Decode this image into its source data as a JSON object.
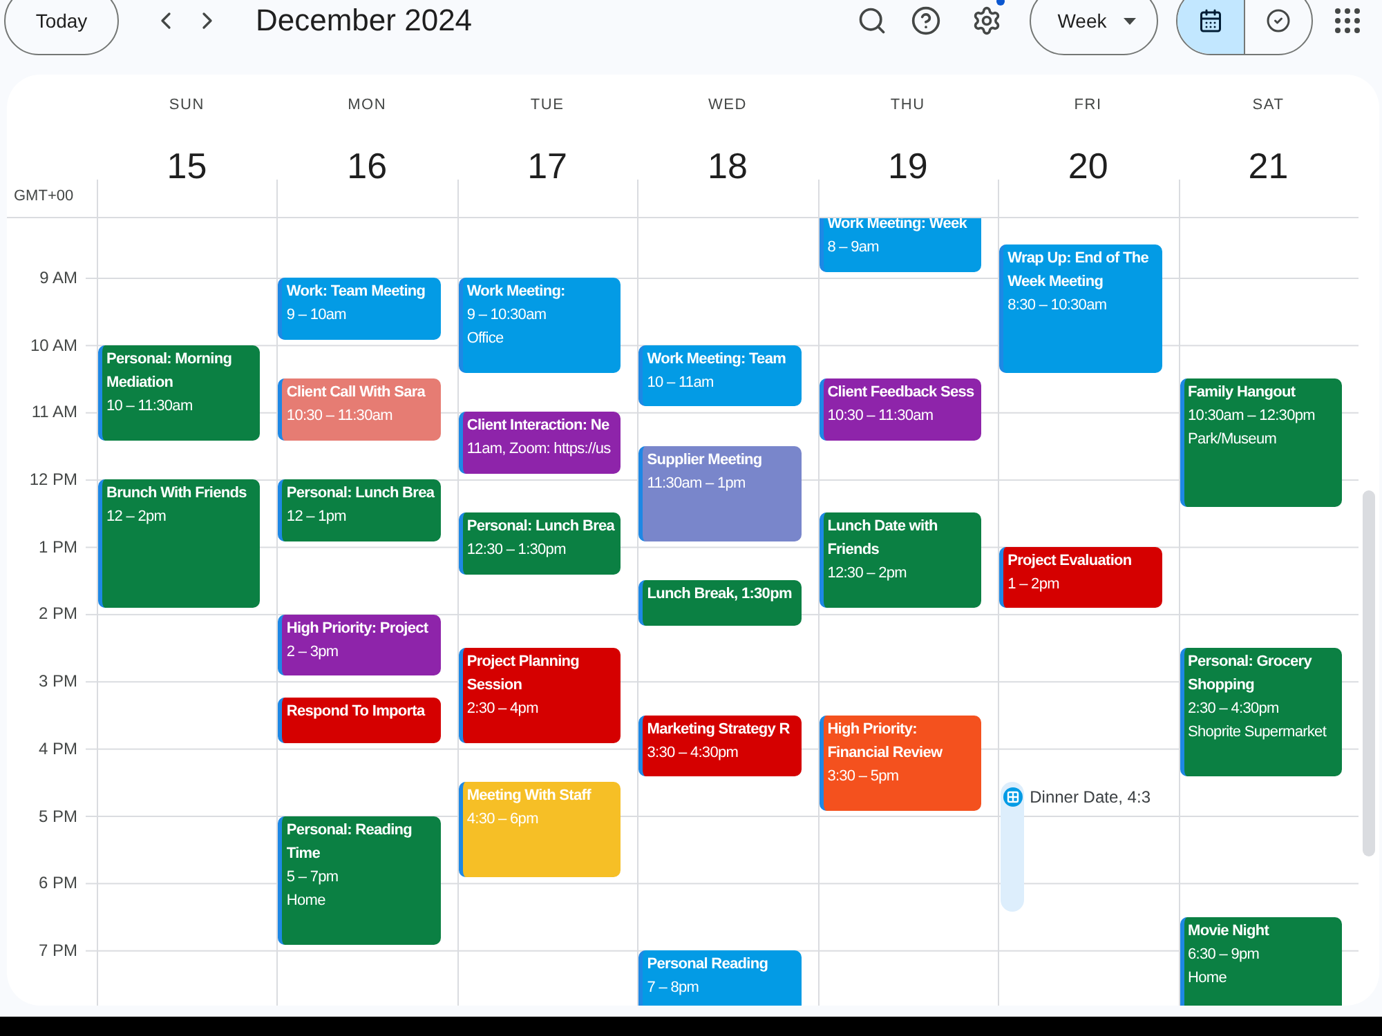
{
  "toolbar": {
    "today": "Today",
    "title": "December 2024",
    "settings_badge": true,
    "view": "Week",
    "view_toggle": [
      {
        "kind": "calendar",
        "selected": true
      },
      {
        "kind": "tasks",
        "selected": false
      }
    ]
  },
  "timezone": "GMT+00",
  "hours": [
    "9 AM",
    "10 AM",
    "11 AM",
    "12 PM",
    "1 PM",
    "2 PM",
    "3 PM",
    "4 PM",
    "5 PM",
    "6 PM",
    "7 PM"
  ],
  "days": [
    {
      "name": "SUN",
      "date": "15",
      "events": [
        {
          "kind": "event",
          "title": "Personal: Morning Mediation",
          "time": "10 – 11:30am",
          "color": "#0b8043"
        },
        {
          "kind": "event",
          "title": "Brunch With Friends",
          "time": "12 – 2pm",
          "color": "#0b8043"
        }
      ]
    },
    {
      "name": "MON",
      "date": "16",
      "events": [
        {
          "kind": "event",
          "title": "Work: Team Meeting",
          "time": "9 – 10am",
          "color": "#039be5"
        },
        {
          "kind": "event",
          "title": "Client Call With Sara",
          "time": "10:30 – 11:30am",
          "color": "#e67c73"
        },
        {
          "kind": "event",
          "title": "Personal: Lunch Brea",
          "time": "12 – 1pm",
          "color": "#0b8043"
        },
        {
          "kind": "event",
          "title": "High Priority: Project",
          "time": "2 – 3pm",
          "color": "#8e24aa"
        },
        {
          "kind": "event",
          "title": "Respond To Importa",
          "color": "#d50000"
        },
        {
          "kind": "event",
          "title": "Personal: Reading Time",
          "time": "5 – 7pm",
          "location": "Home",
          "color": "#0b8043"
        }
      ]
    },
    {
      "name": "TUE",
      "date": "17",
      "events": [
        {
          "kind": "event",
          "title": "Work Meeting:",
          "time": "9 – 10:30am",
          "location": "Office",
          "color": "#039be5"
        },
        {
          "kind": "event",
          "title": "Client Interaction: Ne",
          "time": "11am, Zoom: https://us",
          "color": "#8e24aa"
        },
        {
          "kind": "event",
          "title": "Personal: Lunch Brea",
          "time": "12:30 – 1:30pm",
          "color": "#0b8043"
        },
        {
          "kind": "event",
          "title": "Project Planning Session",
          "time": "2:30 – 4pm",
          "color": "#d50000"
        },
        {
          "kind": "event",
          "title": "Meeting With Staff",
          "time": "4:30 – 6pm",
          "color": "#f6bf26"
        }
      ]
    },
    {
      "name": "WED",
      "date": "18",
      "events": [
        {
          "kind": "event",
          "title": "Work Meeting: Team",
          "time": "10 – 11am",
          "color": "#039be5"
        },
        {
          "kind": "event",
          "title": "Supplier Meeting",
          "time": "11:30am – 1pm",
          "color": "#7986cb"
        },
        {
          "kind": "event",
          "title": "Lunch Break, 1:30pm",
          "color": "#0b8043"
        },
        {
          "kind": "event",
          "title": "Marketing Strategy R",
          "time": "3:30 – 4:30pm",
          "color": "#d50000"
        },
        {
          "kind": "event",
          "title": "Personal Reading",
          "time": "7 – 8pm",
          "color": "#039be5"
        }
      ]
    },
    {
      "name": "THU",
      "date": "19",
      "events": [
        {
          "kind": "event",
          "title": "Work Meeting: Week",
          "time": "8 – 9am",
          "color": "#039be5"
        },
        {
          "kind": "event",
          "title": "Client Feedback Sess",
          "time": "10:30 – 11:30am",
          "color": "#8e24aa"
        },
        {
          "kind": "event",
          "title": "Lunch Date with Friends",
          "time": "12:30 – 2pm",
          "color": "#0b8043"
        },
        {
          "kind": "event",
          "title": "High Priority: Financial Review",
          "time": "3:30 – 5pm",
          "color": "#f4511e"
        }
      ]
    },
    {
      "name": "FRI",
      "date": "20",
      "events": [
        {
          "kind": "event",
          "title": "Wrap Up: End of The Week Meeting",
          "time": "8:30 – 10:30am",
          "color": "#039be5"
        },
        {
          "kind": "event",
          "title": "Project Evaluation",
          "time": "1 – 2pm",
          "color": "#d50000"
        },
        {
          "kind": "task",
          "title": "Dinner Date, 4:3",
          "color": "#039be5"
        }
      ]
    },
    {
      "name": "SAT",
      "date": "21",
      "events": [
        {
          "kind": "event",
          "title": "Family Hangout",
          "time": "10:30am – 12:30pm",
          "location": "Park/Museum",
          "color": "#0b8043"
        },
        {
          "kind": "event",
          "title": "Personal: Grocery Shopping",
          "time": "2:30 – 4:30pm",
          "location": "Shoprite Supermarket",
          "color": "#0b8043"
        },
        {
          "kind": "event",
          "title": "Movie Night",
          "time": "6:30 – 9pm",
          "location": "Home",
          "color": "#0b8043"
        }
      ]
    }
  ]
}
